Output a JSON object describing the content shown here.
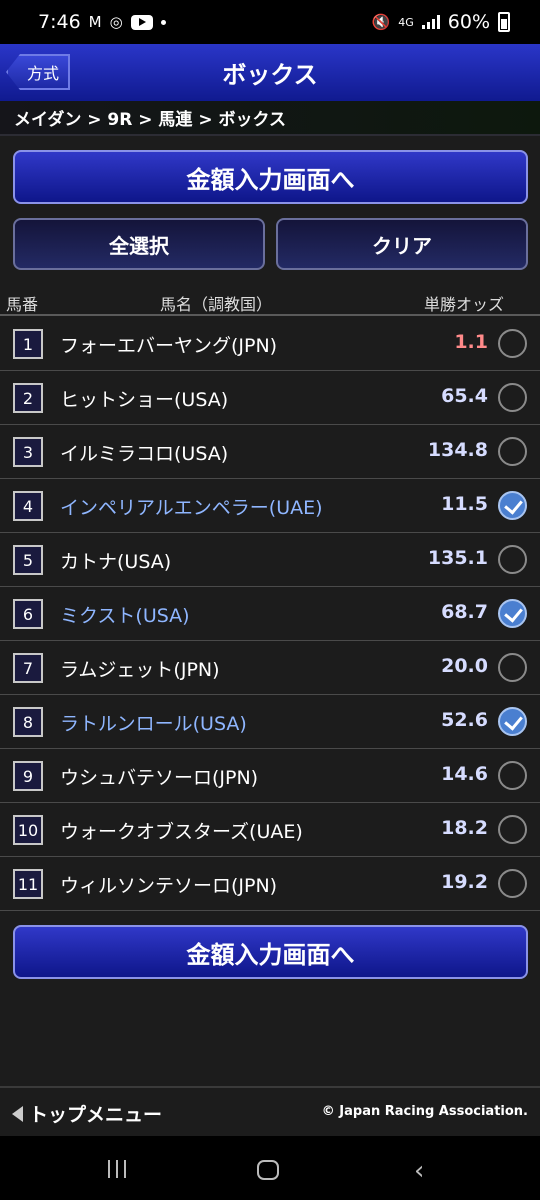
{
  "status": {
    "time": "7:46",
    "network": "4G",
    "battery": "60%"
  },
  "header": {
    "back_label": "方式",
    "title": "ボックス"
  },
  "breadcrumb": "メイダン > 9R > 馬連 > ボックス",
  "buttons": {
    "to_amount": "金額入力画面へ",
    "select_all": "全選択",
    "clear": "クリア"
  },
  "columns": {
    "number": "馬番",
    "name": "馬名（調教国）",
    "odds": "単勝オッズ"
  },
  "horses": [
    {
      "num": "1",
      "name": "フォーエバーヤング(JPN)",
      "odds": "1.1",
      "selected": false
    },
    {
      "num": "2",
      "name": "ヒットショー(USA)",
      "odds": "65.4",
      "selected": false
    },
    {
      "num": "3",
      "name": "イルミラコロ(USA)",
      "odds": "134.8",
      "selected": false
    },
    {
      "num": "4",
      "name": "インペリアルエンペラー(UAE)",
      "odds": "11.5",
      "selected": true
    },
    {
      "num": "5",
      "name": "カトナ(USA)",
      "odds": "135.1",
      "selected": false
    },
    {
      "num": "6",
      "name": "ミクスト(USA)",
      "odds": "68.7",
      "selected": true
    },
    {
      "num": "7",
      "name": "ラムジェット(JPN)",
      "odds": "20.0",
      "selected": false
    },
    {
      "num": "8",
      "name": "ラトルンロール(USA)",
      "odds": "52.6",
      "selected": true
    },
    {
      "num": "9",
      "name": "ウシュバテソーロ(JPN)",
      "odds": "14.6",
      "selected": false
    },
    {
      "num": "10",
      "name": "ウォークオブスターズ(UAE)",
      "odds": "18.2",
      "selected": false
    },
    {
      "num": "11",
      "name": "ウィルソンテソーロ(JPN)",
      "odds": "19.2",
      "selected": false
    }
  ],
  "footer": {
    "top_menu": "トップメニュー",
    "copyright": "© Japan Racing Association."
  },
  "colors": {
    "header": "#1c28b0",
    "selected_text": "#8fb6ff",
    "favorite_odds": "#ff8a8a",
    "check_on": "#4a7fd0"
  }
}
